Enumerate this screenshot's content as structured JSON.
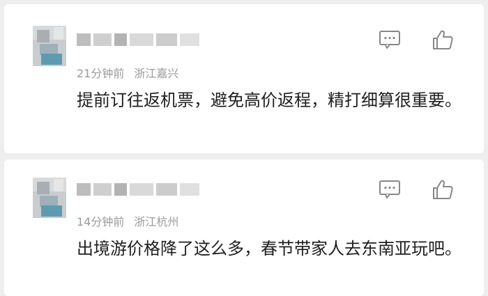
{
  "comments": [
    {
      "time": "21分钟前",
      "location": "浙江嘉兴",
      "text": "提前订往返机票，避免高价返程，精打细算很重要。"
    },
    {
      "time": "14分钟前",
      "location": "浙江杭州",
      "text": "出境游价格降了这么多，春节带家人去东南亚玩吧。"
    }
  ],
  "icons": {
    "comment": "comment-icon",
    "like": "thumbs-up-icon"
  },
  "colors": {
    "meta_text": "#9a9a9a",
    "body_text": "#1f1f1f",
    "icon": "#888888"
  }
}
